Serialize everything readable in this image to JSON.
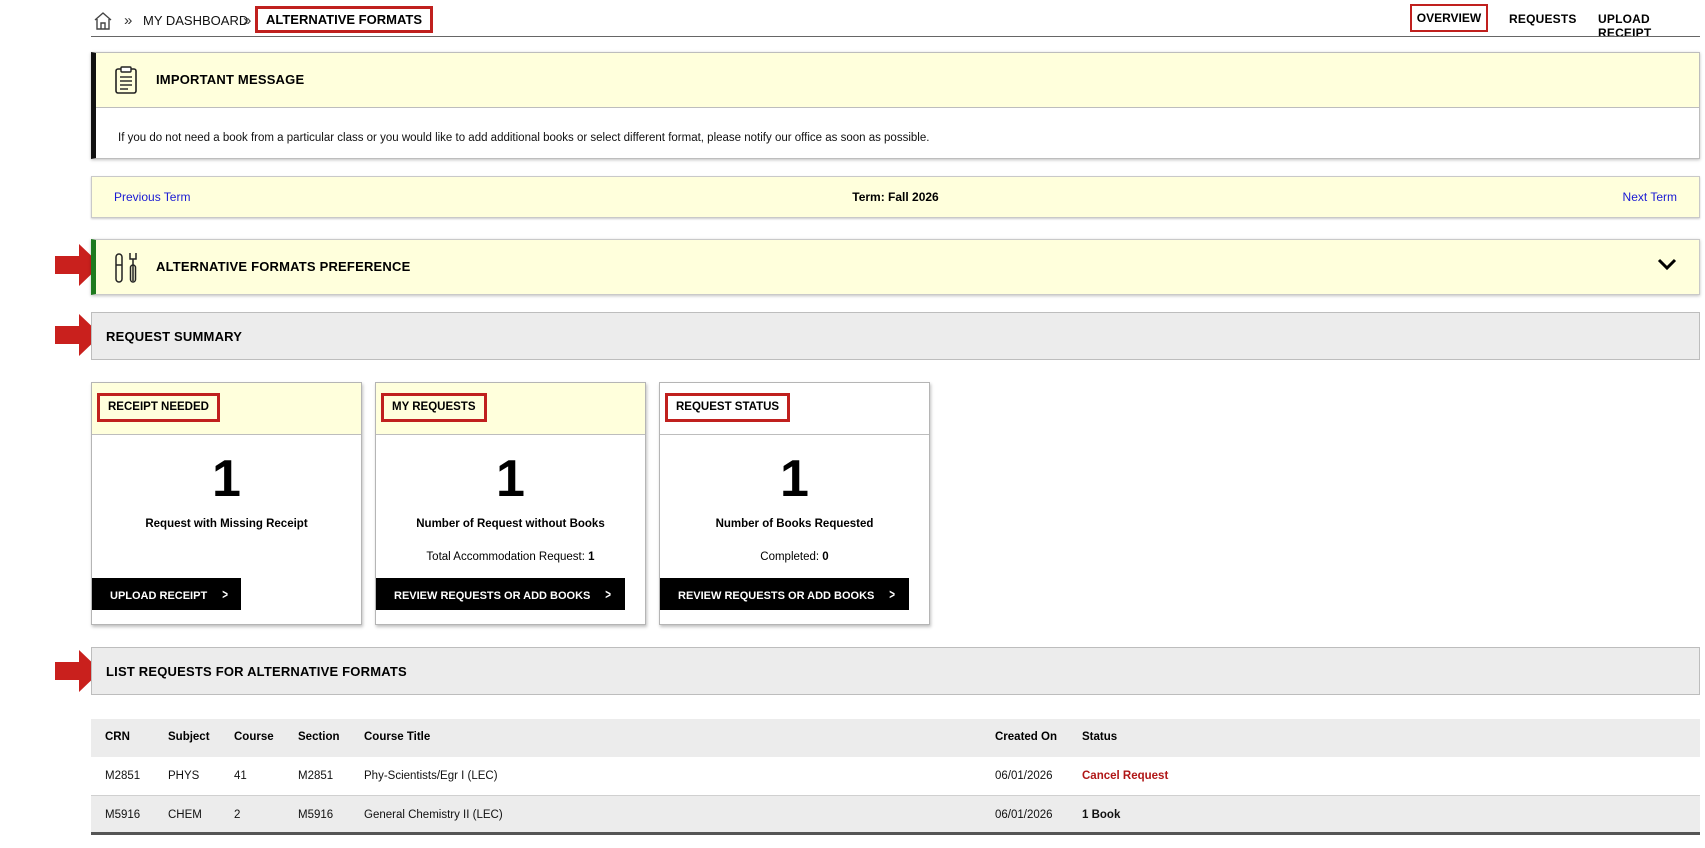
{
  "breadcrumb": {
    "dashboard": "MY DASHBOARD",
    "current": "ALTERNATIVE FORMATS",
    "separator": "»"
  },
  "topnav": {
    "overview": "OVERVIEW",
    "requests": "REQUESTS",
    "upload_receipt": "UPLOAD RECEIPT"
  },
  "important_message": {
    "title": "IMPORTANT MESSAGE",
    "text": "If you do not need a book from a particular class or you would like to add additional books or select different format, please notify our office as soon as possible."
  },
  "term": {
    "previous": "Previous Term",
    "current": "Term: Fall 2026",
    "next": "Next Term"
  },
  "preference": {
    "title": "ALTERNATIVE FORMATS PREFERENCE"
  },
  "request_summary": {
    "title": "REQUEST SUMMARY",
    "cards": [
      {
        "label": "RECEIPT NEEDED",
        "number": "1",
        "description": "Request with Missing Receipt",
        "button": "UPLOAD RECEIPT"
      },
      {
        "label": "MY REQUESTS",
        "number": "1",
        "description": "Number of Request without Books",
        "sub_label": "Total Accommodation Request:",
        "sub_value": "1",
        "button": "REVIEW REQUESTS OR ADD BOOKS"
      },
      {
        "label": "REQUEST STATUS",
        "number": "1",
        "description": "Number of Books Requested",
        "sub_label": "Completed:",
        "sub_value": "0",
        "button": "REVIEW REQUESTS OR ADD BOOKS"
      }
    ]
  },
  "requests_list": {
    "title": "LIST REQUESTS FOR ALTERNATIVE FORMATS",
    "columns": [
      "CRN",
      "Subject",
      "Course",
      "Section",
      "Course Title",
      "Created On",
      "Status"
    ],
    "rows": [
      {
        "crn": "M2851",
        "subject": "PHYS",
        "course": "41",
        "section": "M2851",
        "course_title": "Phy-Scientists/Egr I (LEC)",
        "created_on": "06/01/2026",
        "status": "Cancel Request"
      },
      {
        "crn": "M5916",
        "subject": "CHEM",
        "course": "2",
        "section": "M5916",
        "course_title": "General Chemistry II (LEC)",
        "created_on": "06/01/2026",
        "status": "1 Book"
      }
    ]
  },
  "colors": {
    "highlight_border": "#c0201e",
    "yellow_panel": "#ffffdc",
    "link_blue": "#1a1ad4",
    "pref_accent": "#1e7a1e",
    "cancel_red": "#b01616"
  },
  "icons": {
    "home": "home-icon",
    "clipboard": "clipboard-icon",
    "tools": "tools-icon",
    "chevron_down": "chevron-down-icon",
    "chevron_right": "chevron-right-icon",
    "arrow": "red-arrow-icon"
  }
}
